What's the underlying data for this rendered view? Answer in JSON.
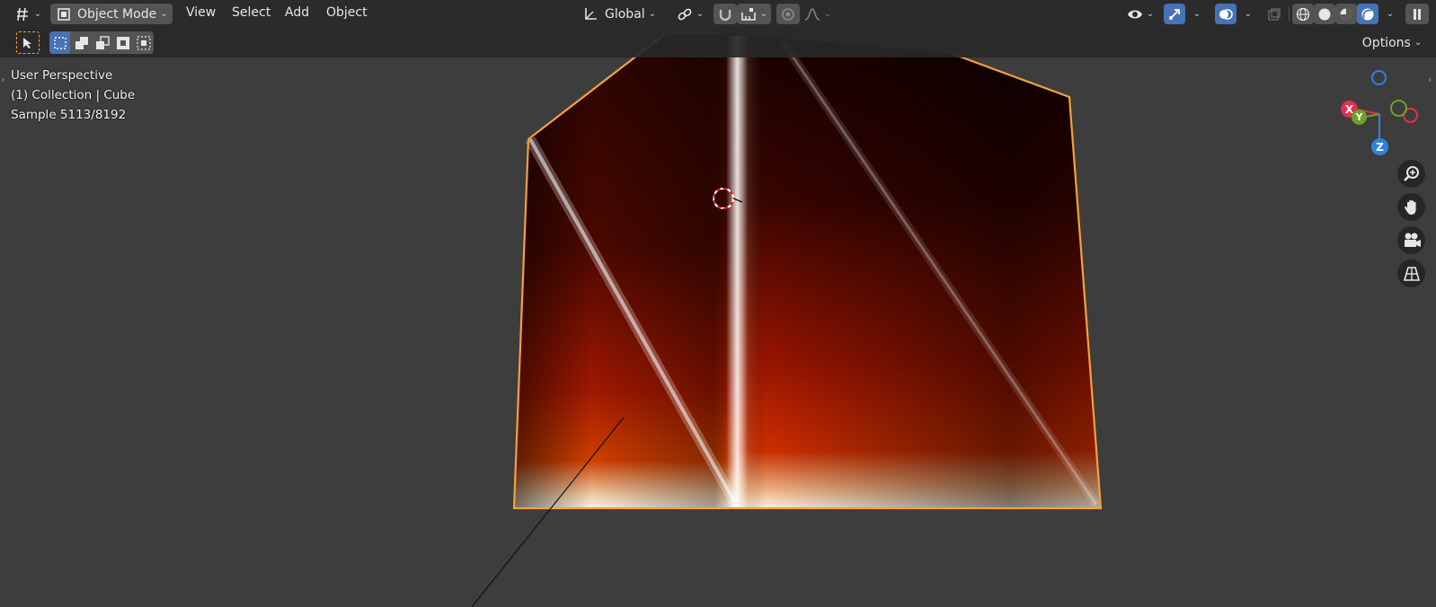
{
  "header": {
    "mode_label": "Object Mode",
    "menus": [
      "View",
      "Select",
      "Add",
      "Object"
    ],
    "transform_orientation": "Global"
  },
  "toolbar": {
    "options_label": "Options"
  },
  "viewport": {
    "view_name": "User Perspective",
    "collection_info": "(1) Collection | Cube",
    "sample_info": "Sample 5113/8192"
  },
  "gizmo": {
    "x_label": "X",
    "y_label": "Y",
    "z_label": "Z"
  },
  "icons": {
    "editor_type": "grid-editor-icon",
    "select_tool": "cursor-select-icon",
    "navigation": [
      "zoom-icon",
      "hand-pan-icon",
      "camera-icon",
      "perspective-grid-icon"
    ]
  },
  "colors": {
    "accent_blue": "#4772b3",
    "selection_orange": "#f5a03c",
    "axis_x": "#e0304d",
    "axis_y": "#6aa22a",
    "axis_z": "#2f82e0"
  }
}
